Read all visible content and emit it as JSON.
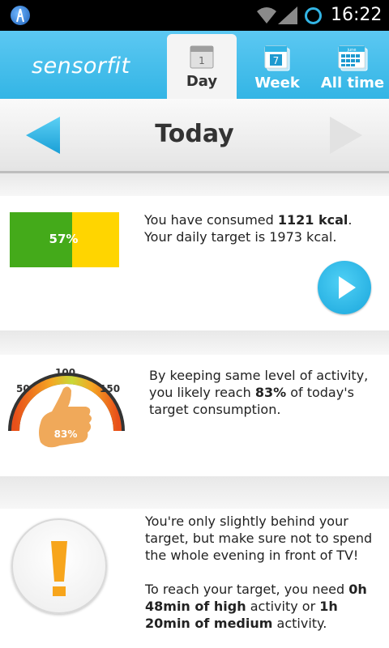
{
  "status_bar": {
    "time": "16:22",
    "icons": [
      "app-icon",
      "wifi-icon",
      "signal-icon",
      "sync-icon"
    ]
  },
  "header": {
    "logo": "sensorfit",
    "tabs": [
      {
        "label": "Day",
        "icon": "calendar-day-icon",
        "icon_text": "1",
        "selected": true
      },
      {
        "label": "Week",
        "icon": "calendar-week-icon",
        "icon_text": "7",
        "selected": false
      },
      {
        "label": "All time",
        "icon": "calendar-month-icon",
        "icon_text": "june",
        "selected": false
      }
    ],
    "accent_color": "#33b5e5"
  },
  "date_nav": {
    "title": "Today",
    "prev_icon": "arrow-left-icon",
    "next_icon": "arrow-right-icon"
  },
  "cards": {
    "consumption": {
      "percent": 57,
      "percent_label": "57%",
      "line1_prefix": "You have consumed ",
      "line1_value": "1121 kcal",
      "line1_suffix": ".",
      "line2": "Your daily target is 1973 kcal.",
      "play_icon": "play-icon",
      "colors": {
        "consumed": "#44aa1a",
        "remaining": "#ffd500"
      }
    },
    "forecast": {
      "gauge": {
        "ticks": [
          "50",
          "100",
          "150"
        ],
        "value": 83,
        "value_label": "83%",
        "icon": "thumbs-up-icon"
      },
      "text_prefix": "By keeping same level of activity, you likely reach ",
      "text_value": "83%",
      "text_suffix": " of today's target consumption."
    },
    "advice": {
      "icon": "exclamation-icon",
      "para1": "You're only slightly behind your target, but make sure not to spend the whole evening in front of TV!",
      "para2_prefix": "To reach your target, you need ",
      "para2_value1": "0h 48min of high",
      "para2_mid": " activity or ",
      "para2_value2": "1h 20min of medium",
      "para2_suffix": " activity."
    }
  }
}
